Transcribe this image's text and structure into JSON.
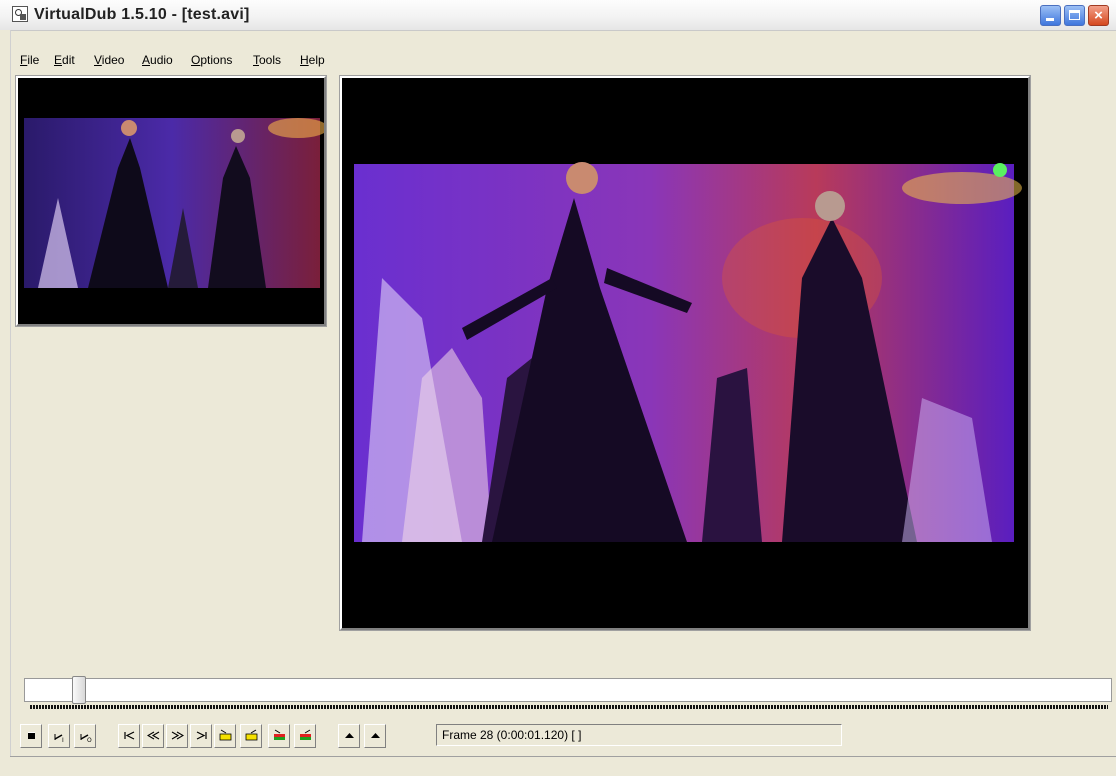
{
  "window": {
    "title": "VirtualDub 1.5.10 - [test.avi]",
    "icon": "virtualdub-app-icon",
    "close_glyph": "×"
  },
  "menu": [
    {
      "label": "File",
      "accel": "F",
      "rest": "ile"
    },
    {
      "label": "Edit",
      "accel": "E",
      "rest": "dit"
    },
    {
      "label": "Video",
      "accel": "V",
      "rest": "ideo"
    },
    {
      "label": "Audio",
      "accel": "A",
      "rest": "udio"
    },
    {
      "label": "Options",
      "accel": "O",
      "rest": "ptions"
    },
    {
      "label": "Tools",
      "accel": "T",
      "rest": "ools"
    },
    {
      "label": "Help",
      "accel": "H",
      "rest": "elp"
    }
  ],
  "seek": {
    "position_fraction": 0.045
  },
  "toolbar": {
    "buttons": [
      {
        "name": "stop-icon"
      },
      {
        "name": "play-input-icon"
      },
      {
        "name": "play-output-icon"
      },
      {
        "name": "start-icon"
      },
      {
        "name": "back-icon"
      },
      {
        "name": "forward-icon"
      },
      {
        "name": "end-icon"
      },
      {
        "name": "prev-keyframe-icon"
      },
      {
        "name": "next-keyframe-icon"
      },
      {
        "name": "prev-scene-icon"
      },
      {
        "name": "next-scene-icon"
      },
      {
        "name": "mark-in-icon"
      },
      {
        "name": "mark-out-icon"
      }
    ]
  },
  "status": {
    "frame_text": "Frame 28 (0:00:01.120) [ ]"
  },
  "colors": {
    "accent": "#3f76dd",
    "close": "#d5491f",
    "video_bg": "#000000",
    "stage_purple": "#7a2fd0"
  }
}
